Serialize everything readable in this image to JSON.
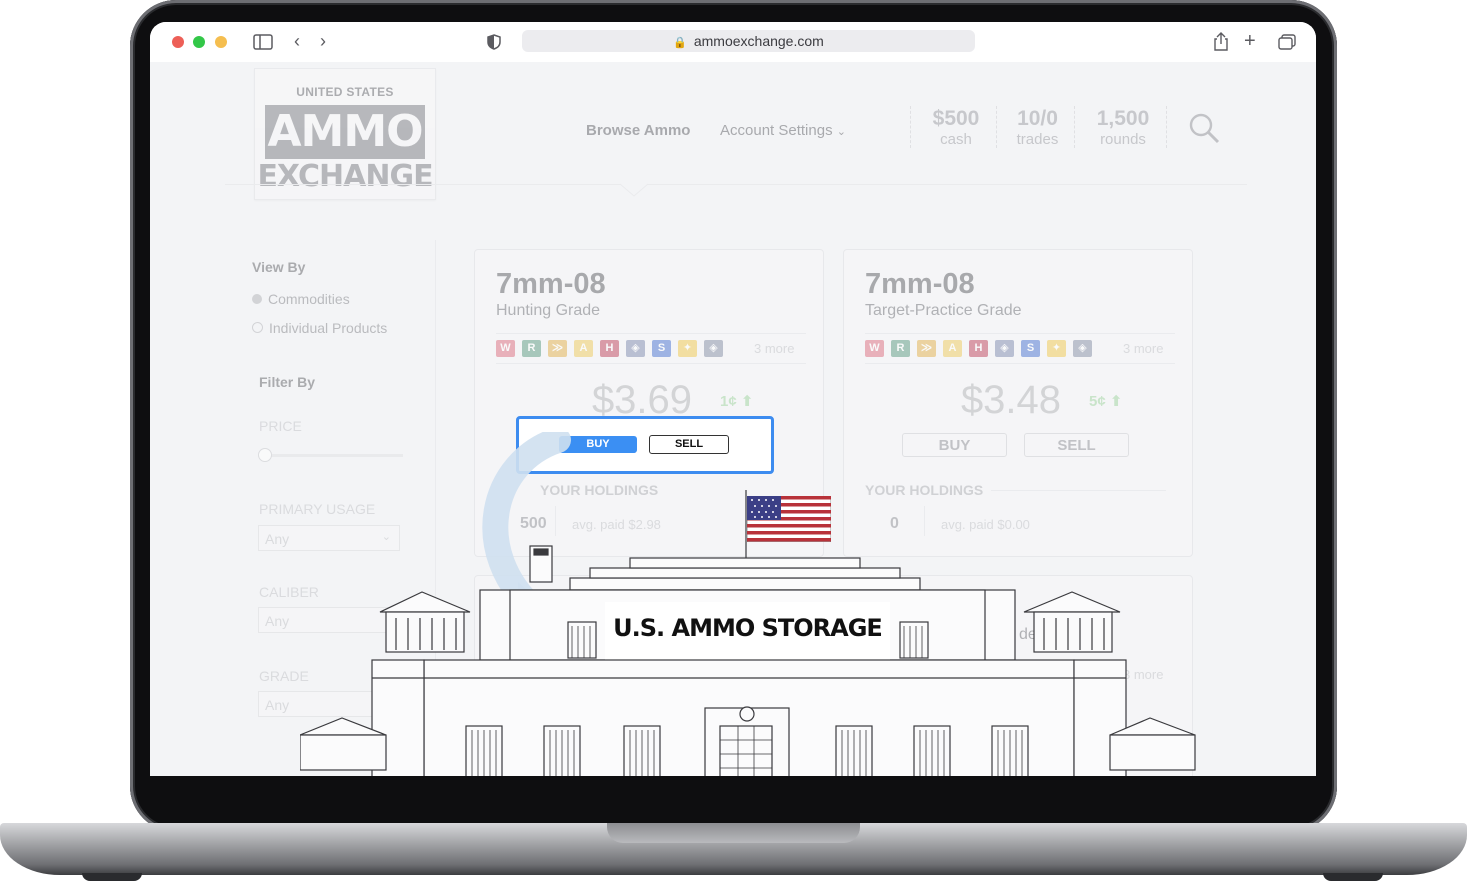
{
  "browser": {
    "url": "ammoexchange.com"
  },
  "logo": {
    "top_text": "UNITED STATES",
    "middle_text": "AMMO",
    "bottom_text": "EXCHANGE"
  },
  "nav": {
    "browse": "Browse Ammo",
    "account": "Account Settings"
  },
  "stats": [
    {
      "value": "$500",
      "label": "cash"
    },
    {
      "value": "10/0",
      "label": "trades"
    },
    {
      "value": "1,500",
      "label": "rounds"
    }
  ],
  "sidebar": {
    "view_by": "View By",
    "view_options": [
      "Commodities",
      "Individual Products"
    ],
    "filter_by": "Filter By",
    "price_label": "PRICE",
    "usage_label": "PRIMARY USAGE",
    "usage_value": "Any",
    "caliber_label": "CALIBER",
    "caliber_value": "Any",
    "grade_label": "GRADE",
    "grade_value": "Any"
  },
  "brand_badges": [
    {
      "glyph": "W",
      "color": "#e07a8a"
    },
    {
      "glyph": "R",
      "color": "#6aa38c"
    },
    {
      "glyph": "≫",
      "color": "#e6b85a"
    },
    {
      "glyph": "A",
      "color": "#f0cf6a"
    },
    {
      "glyph": "H",
      "color": "#c4546a"
    },
    {
      "glyph": "◈",
      "color": "#8b95b5"
    },
    {
      "glyph": "S",
      "color": "#5a7fd4"
    },
    {
      "glyph": "✦",
      "color": "#f2cd5c"
    },
    {
      "glyph": "◈",
      "color": "#9098ac"
    }
  ],
  "cards": [
    {
      "caliber": "7mm-08",
      "grade": "Hunting Grade",
      "more": "3 more",
      "price": "$3.69",
      "change": "1¢",
      "buy": "BUY",
      "sell": "SELL",
      "holdings_label": "YOUR HOLDINGS",
      "holdings_qty": "500",
      "avg_paid": "avg. paid $2.98"
    },
    {
      "caliber": "7mm-08",
      "grade": "Target-Practice Grade",
      "more": "3 more",
      "price": "$3.48",
      "change": "5¢",
      "buy": "BUY",
      "sell": "SELL",
      "holdings_label": "YOUR HOLDINGS",
      "holdings_qty": "0",
      "avg_paid": "avg. paid $0.00"
    }
  ],
  "partial_card": {
    "more": "3 more",
    "grade_tail": "de"
  },
  "highlight": {
    "buy": "BUY",
    "sell": "SELL"
  },
  "vault": {
    "sign": "U.S. AMMO STORAGE"
  }
}
